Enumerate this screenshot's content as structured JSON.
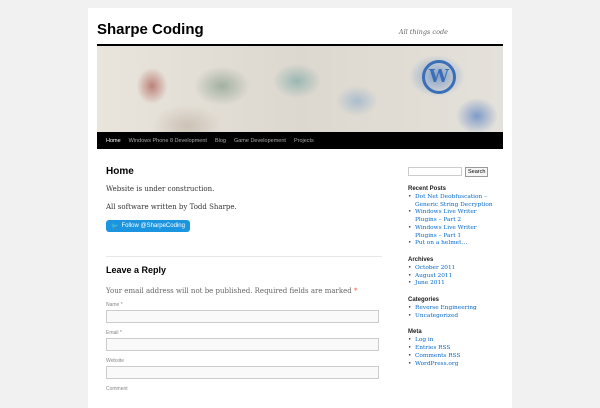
{
  "site": {
    "title": "Sharpe Coding",
    "tagline": "All things code"
  },
  "nav": [
    "Home",
    "Windows Phone 8 Development",
    "Blog",
    "Game Developement",
    "Projects"
  ],
  "page": {
    "title": "Home",
    "p1": "Website is under construction.",
    "p2": "All software written by Todd Sharpe.",
    "follow": "Follow @SharpeCoding"
  },
  "reply": {
    "title": "Leave a Reply",
    "note": "Your email address will not be published. Required fields are marked",
    "req": "*",
    "name": "Name *",
    "email": "Email *",
    "website": "Website",
    "comment": "Comment"
  },
  "sidebar": {
    "search_button": "Search",
    "recent_title": "Recent Posts",
    "recent": [
      "Dot Net Deobfuscation – Generic String Decryption",
      "Windows Live Writer Plugins – Part 2",
      "Windows Live Writer Plugins – Part 1",
      "Put on a helmet…"
    ],
    "archives_title": "Archives",
    "archives": [
      "October 2011",
      "August 2011",
      "June 2011"
    ],
    "categories_title": "Categories",
    "categories": [
      "Reverse Engineering",
      "Uncategorized"
    ],
    "meta_title": "Meta",
    "meta": [
      "Log in",
      "Entries RSS",
      "Comments RSS",
      "WordPress.org"
    ]
  }
}
